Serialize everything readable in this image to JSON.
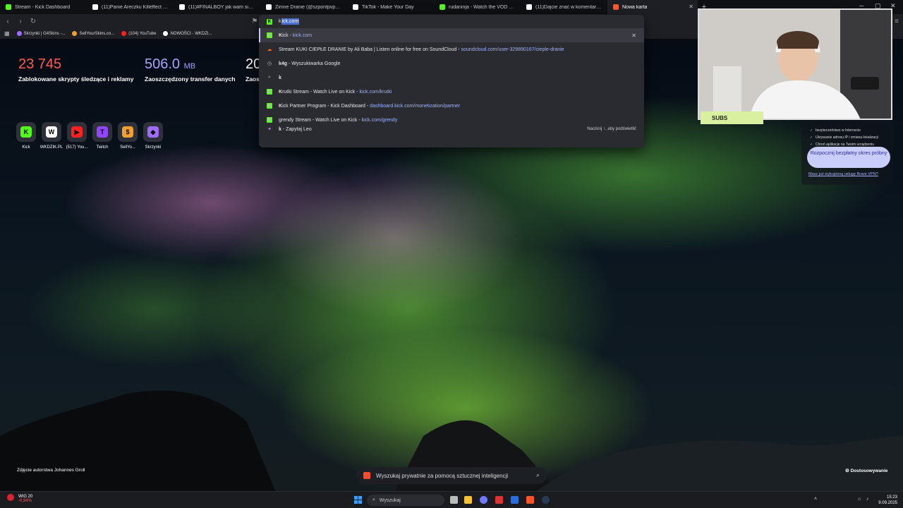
{
  "tabs": [
    {
      "label": "Stream - Kick Dashboard",
      "color": "#53fc18"
    },
    {
      "label": "(11)Panie Areczku Killeffect jest dla z",
      "color": "#ffffff"
    },
    {
      "label": "(11)#FINALBOY jak wam się podoba",
      "color": "#ffffff"
    },
    {
      "label": "Zimne Dranie (@szpontpvp) | TikTok",
      "color": "#ffffff"
    },
    {
      "label": "TikTok - Make Your Day",
      "color": "#ffffff"
    },
    {
      "label": "rudaninja - Watch the VOD on Kick",
      "color": "#53fc18"
    },
    {
      "label": "(11)Dajcie znać w komentarzu kto de",
      "color": "#ffffff"
    },
    {
      "label": "Nowa karta",
      "color": "#ff5a2b"
    }
  ],
  "bookmarks": [
    {
      "label": "Skrzynki | G4Skins -...",
      "color": "#a06bff"
    },
    {
      "label": "SellYourSkins.co...",
      "color": "#f0a030"
    },
    {
      "label": "(104) YouTube",
      "color": "#ff2020"
    },
    {
      "label": "NOWOŚCI - WKDZI...",
      "color": "#ffffff"
    }
  ],
  "omnibox": {
    "typed": "k",
    "completion": "ick.com",
    "suggestions": [
      {
        "icon": "kick",
        "bold": "K",
        "title": "ick - ",
        "url": "kick.com",
        "selected": true
      },
      {
        "icon": "soundcloud",
        "bold": "",
        "title": "Stream KUKI CIEPŁE DRANIE by Ali Baba | Listen online for free on SoundCloud",
        "url": "soundcloud.com/user-329890167/cieple-dranie"
      },
      {
        "icon": "history",
        "bold": "k4g",
        "title": " - Wyszukiwarka Google",
        "url": ""
      },
      {
        "icon": "search",
        "bold": "k",
        "title": "",
        "url": ""
      },
      {
        "icon": "kick",
        "bold": "K",
        "title": "rutki Stream - Watch Live on Kick - ",
        "url": "kick.com/krutki"
      },
      {
        "icon": "kick",
        "bold": "K",
        "title": "ick Partner Program - Kick Dashboard - ",
        "url": "dashboard.kick.com/monetization/partner"
      },
      {
        "icon": "kick",
        "bold": "",
        "title": "grendy Stream - Watch Live on Kick - ",
        "url": "kick.com/grendy"
      },
      {
        "icon": "leo",
        "bold": "k",
        "title": " - Zapytaj Leo",
        "url": ""
      }
    ],
    "hint": "Naciśnij ↑, aby podświetlić"
  },
  "stats": [
    {
      "value": "23 745",
      "unit": "",
      "label": "Zablokowane skrypty śledzące i reklamy",
      "color": "#ff5a4a"
    },
    {
      "value": "506.0",
      "unit": "MB",
      "label": "Zaoszczędzony transfer danych",
      "color": "#a7a3ff"
    },
    {
      "value": "20",
      "unit": "",
      "label": "Zaos",
      "color": "#ffffff"
    }
  ],
  "top_sites": [
    {
      "name": "Kick",
      "glyph": "K",
      "color": "#53fc18"
    },
    {
      "name": "WKDZIK.PL",
      "glyph": "W",
      "color": "#ffffff"
    },
    {
      "name": "(517) You...",
      "glyph": "▶",
      "color": "#ff2020"
    },
    {
      "name": "Twitch",
      "glyph": "T",
      "color": "#9146ff"
    },
    {
      "name": "SellYo...",
      "glyph": "$",
      "color": "#f0a030"
    },
    {
      "name": "Skrzynki",
      "glyph": "◆",
      "color": "#a06bff"
    }
  ],
  "vpn": {
    "lines": [
      "bezpieczeństwo w Internecie",
      "Ukrywanie adresu IP i zmiana lokalizacji",
      "Chroń aplikacje na Twoim urządzeniu"
    ],
    "button": "Rozpocznij bezpłatny okres próbny",
    "link": "Masz już wykupioną usługę Brave VPN?"
  },
  "webcam": {
    "subs_label": "SUBS"
  },
  "photo_credit": "Zdjęcie autorstwa Johannes Groll",
  "customize": "Dostosowywanie",
  "leo_search": "Wyszukaj prywatnie za pomocą sztucznej inteligencji",
  "taskbar": {
    "ticker_name": "WIG 20",
    "ticker_change": "-0,94%",
    "search": "Wyszukaj",
    "time": "15:23",
    "date": "9.09.2025"
  }
}
